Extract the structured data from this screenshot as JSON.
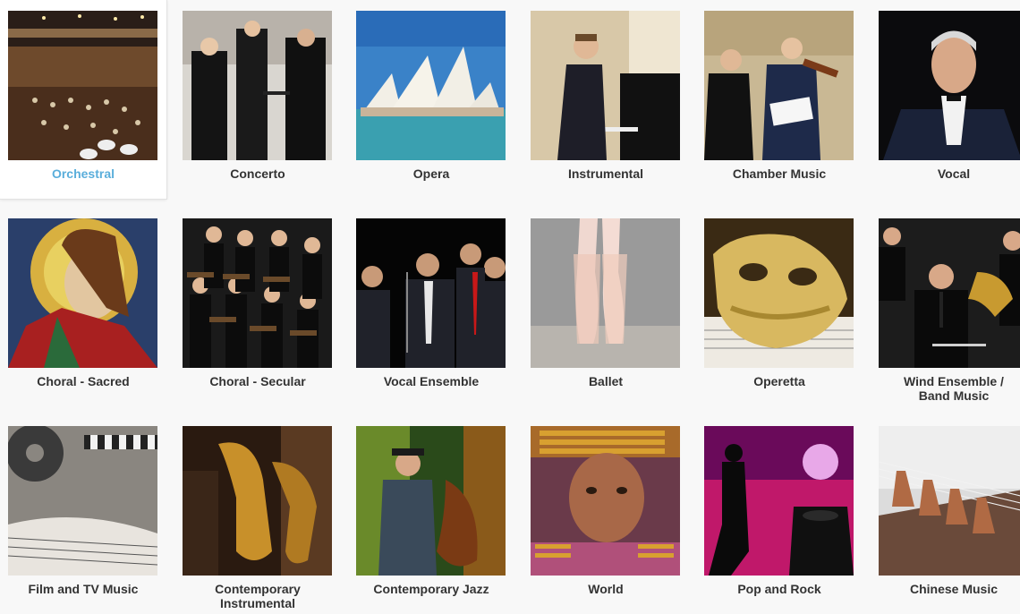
{
  "categories": [
    {
      "id": "orchestral",
      "label": "Orchestral",
      "selected": true,
      "icon": "orchestra-hall-photo"
    },
    {
      "id": "concerto",
      "label": "Concerto",
      "selected": false,
      "icon": "concerto-photo"
    },
    {
      "id": "opera",
      "label": "Opera",
      "selected": false,
      "icon": "opera-house-photo"
    },
    {
      "id": "instrumental",
      "label": "Instrumental",
      "selected": false,
      "icon": "pianist-photo"
    },
    {
      "id": "chamber-music",
      "label": "Chamber Music",
      "selected": false,
      "icon": "string-players-photo"
    },
    {
      "id": "vocal",
      "label": "Vocal",
      "selected": false,
      "icon": "singer-photo"
    },
    {
      "id": "choral-sacred",
      "label": "Choral - Sacred",
      "selected": false,
      "icon": "stained-glass-photo"
    },
    {
      "id": "choral-secular",
      "label": "Choral - Secular",
      "selected": false,
      "icon": "choir-photo"
    },
    {
      "id": "vocal-ensemble",
      "label": "Vocal Ensemble",
      "selected": false,
      "icon": "vocal-group-photo"
    },
    {
      "id": "ballet",
      "label": "Ballet",
      "selected": false,
      "icon": "pointe-shoes-photo"
    },
    {
      "id": "operetta",
      "label": "Operetta",
      "selected": false,
      "icon": "golden-mask-photo"
    },
    {
      "id": "wind-ensemble",
      "label": "Wind Ensemble /\nBand Music",
      "selected": false,
      "icon": "wind-band-photo"
    },
    {
      "id": "film-tv",
      "label": "Film and TV Music",
      "selected": false,
      "icon": "film-reel-photo"
    },
    {
      "id": "contemporary-instrumental",
      "label": "Contemporary\nInstrumental",
      "selected": false,
      "icon": "saxophone-photo"
    },
    {
      "id": "contemporary-jazz",
      "label": "Contemporary Jazz",
      "selected": false,
      "icon": "jazz-bassist-photo"
    },
    {
      "id": "world",
      "label": "World",
      "selected": false,
      "icon": "world-portrait-photo"
    },
    {
      "id": "pop-rock",
      "label": "Pop and Rock",
      "selected": false,
      "icon": "rock-concert-photo"
    },
    {
      "id": "chinese-music",
      "label": "Chinese Music",
      "selected": false,
      "icon": "guzheng-photo"
    }
  ],
  "colors": {
    "selected_label": "#5aaedb",
    "label": "#333333",
    "background": "#f8f8f8"
  }
}
